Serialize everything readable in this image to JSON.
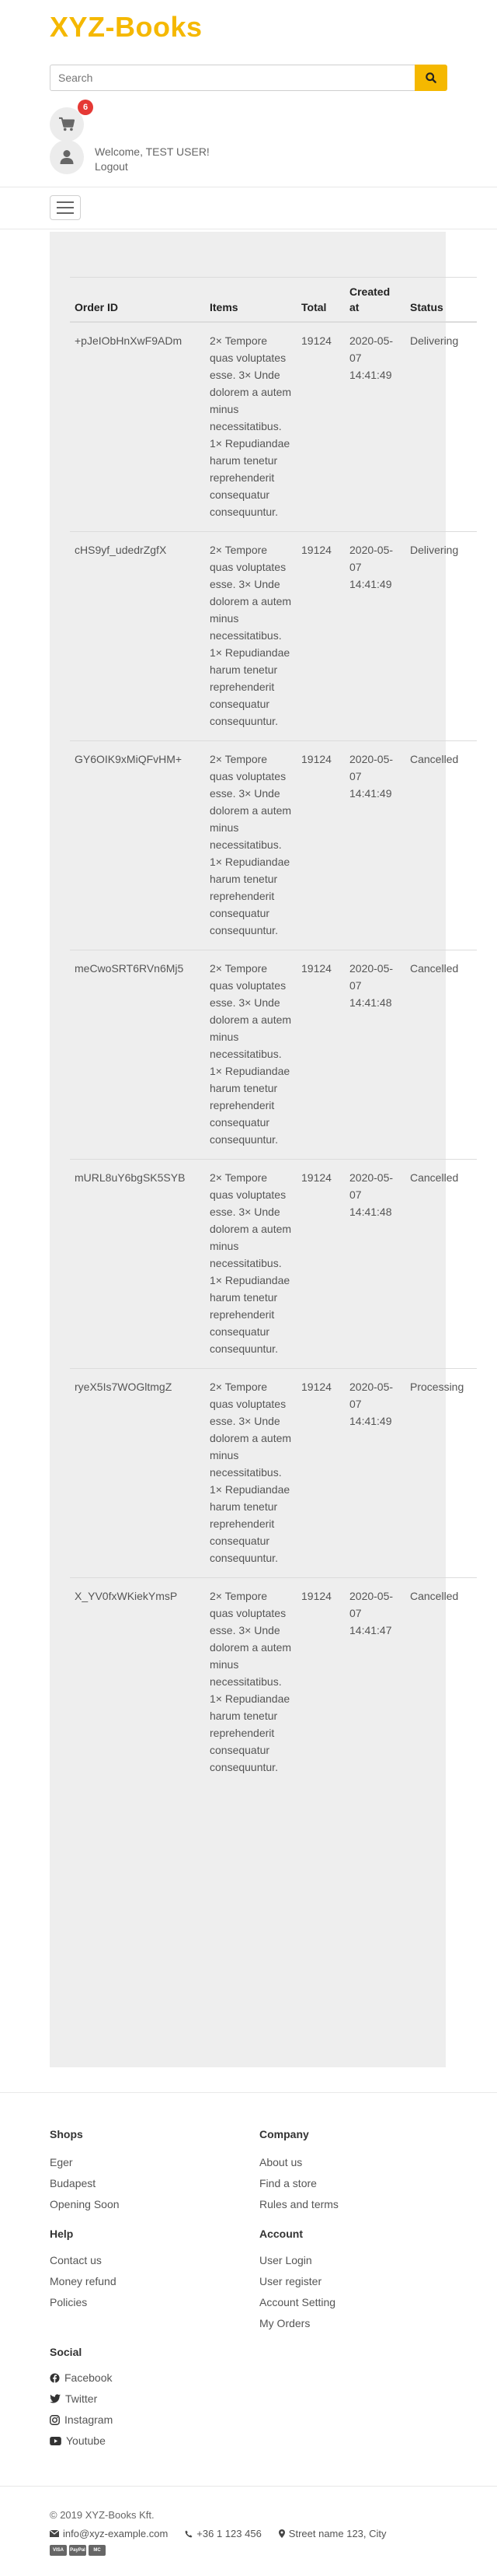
{
  "header": {
    "brand": "XYZ-Books",
    "search_placeholder": "Search",
    "cart_count": "6",
    "welcome": "Welcome, TEST USER!",
    "logout": "Logout"
  },
  "orders": {
    "headers": {
      "id": "Order ID",
      "items": "Items",
      "total": "Total",
      "created": "Created at",
      "status": "Status"
    },
    "rows": [
      {
        "id": "+pJeIObHnXwF9ADm",
        "items": "2× Tempore quas voluptates esse. 3× Unde dolorem a autem minus necessitatibus. 1× Repudiandae harum tenetur reprehenderit consequatur consequuntur.",
        "total": "19124",
        "created": "2020-05-07 14:41:49",
        "status": "Delivering"
      },
      {
        "id": "cHS9yf_udedrZgfX",
        "items": "2× Tempore quas voluptates esse. 3× Unde dolorem a autem minus necessitatibus. 1× Repudiandae harum tenetur reprehenderit consequatur consequuntur.",
        "total": "19124",
        "created": "2020-05-07 14:41:49",
        "status": "Delivering"
      },
      {
        "id": "GY6OIK9xMiQFvHM+",
        "items": "2× Tempore quas voluptates esse. 3× Unde dolorem a autem minus necessitatibus. 1× Repudiandae harum tenetur reprehenderit consequatur consequuntur.",
        "total": "19124",
        "created": "2020-05-07 14:41:49",
        "status": "Cancelled"
      },
      {
        "id": "meCwoSRT6RVn6Mj5",
        "items": "2× Tempore quas voluptates esse. 3× Unde dolorem a autem minus necessitatibus. 1× Repudiandae harum tenetur reprehenderit consequatur consequuntur.",
        "total": "19124",
        "created": "2020-05-07 14:41:48",
        "status": "Cancelled"
      },
      {
        "id": "mURL8uY6bgSK5SYB",
        "items": "2× Tempore quas voluptates esse. 3× Unde dolorem a autem minus necessitatibus. 1× Repudiandae harum tenetur reprehenderit consequatur consequuntur.",
        "total": "19124",
        "created": "2020-05-07 14:41:48",
        "status": "Cancelled"
      },
      {
        "id": "ryeX5Is7WOGltmgZ",
        "items": "2× Tempore quas voluptates esse. 3× Unde dolorem a autem minus necessitatibus. 1× Repudiandae harum tenetur reprehenderit consequatur consequuntur.",
        "total": "19124",
        "created": "2020-05-07 14:41:49",
        "status": "Processing"
      },
      {
        "id": "X_YV0fxWKiekYmsP",
        "items": "2× Tempore quas voluptates esse. 3× Unde dolorem a autem minus necessitatibus. 1× Repudiandae harum tenetur reprehenderit consequatur consequuntur.",
        "total": "19124",
        "created": "2020-05-07 14:41:47",
        "status": "Cancelled"
      }
    ]
  },
  "footer": {
    "shops": {
      "title": "Shops",
      "links": [
        "Eger",
        "Budapest",
        "Opening Soon"
      ]
    },
    "company": {
      "title": "Company",
      "links": [
        "About us",
        "Find a store",
        "Rules and terms"
      ]
    },
    "help": {
      "title": "Help",
      "links": [
        "Contact us",
        "Money refund",
        "Policies"
      ]
    },
    "account": {
      "title": "Account",
      "links": [
        "User Login",
        "User register",
        "Account Setting",
        "My Orders"
      ]
    },
    "social": {
      "title": "Social",
      "links": [
        "Facebook",
        "Twitter",
        "Instagram",
        "Youtube"
      ]
    },
    "copyright": "© 2019 XYZ-Books Kft.",
    "email": "info@xyz-example.com",
    "phone": "+36 1 123 456",
    "address": "Street name 123, City",
    "payments": [
      "VISA",
      "PayPal",
      "MC"
    ]
  },
  "colors": {
    "brand": "#f5b800",
    "badge": "#e53935",
    "panel": "#eeeeee"
  }
}
